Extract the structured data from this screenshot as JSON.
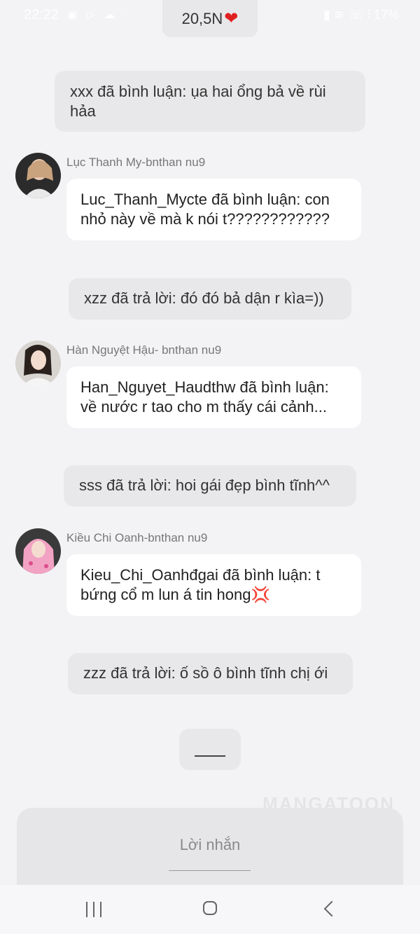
{
  "status_bar": {
    "time": "22:22",
    "battery": "17%",
    "left_icons": [
      "gallery-icon",
      "play-icon",
      "cloud-icon",
      "dot-icon"
    ],
    "right_icons": [
      "sim-icon",
      "wifi-icon",
      "call-icon",
      "signal-icon"
    ]
  },
  "likes": {
    "count": "20,5N",
    "icon": "heart-icon"
  },
  "messages": [
    {
      "type": "system",
      "text": "xxx đã bình luận: ụa hai ổng bả về rùi hảa"
    },
    {
      "type": "user",
      "sender": "Lục Thanh My-bnthan nu9",
      "avatar": "avatar-luc-thanh-my",
      "text": "Luc_Thanh_Mycte đã bình luận: con nhỏ này về mà k nói t????????????"
    },
    {
      "type": "system",
      "text": "xzz đã trả lời: đó đó bả dận r kìa=))"
    },
    {
      "type": "user",
      "sender": "Hàn Nguyệt Hậu- bnthan nu9",
      "avatar": "avatar-han-nguyet-hau",
      "text": "Han_Nguyet_Haudthw đã bình luận: về nước r tao cho m thấy cái cảnh..."
    },
    {
      "type": "system",
      "text": "sss đã trả lời: hoi gái đẹp bình tĩnh^^"
    },
    {
      "type": "user",
      "sender": "Kiều Chi Oanh-bnthan nu9",
      "avatar": "avatar-kieu-chi-oanh",
      "text": "Kieu_Chi_Oanhđgai đã bình luận: t bứng cổ m lun á tin hong💢"
    },
    {
      "type": "system",
      "text": "zzz đã trả lời: ố sồ ô bình tĩnh chị ới"
    }
  ],
  "typing_indicator": "____",
  "watermark": "MANGATOON",
  "input": {
    "placeholder": "Lời nhắn"
  },
  "nav_bar": {
    "items": [
      "recents-icon",
      "home-icon",
      "back-icon"
    ]
  }
}
